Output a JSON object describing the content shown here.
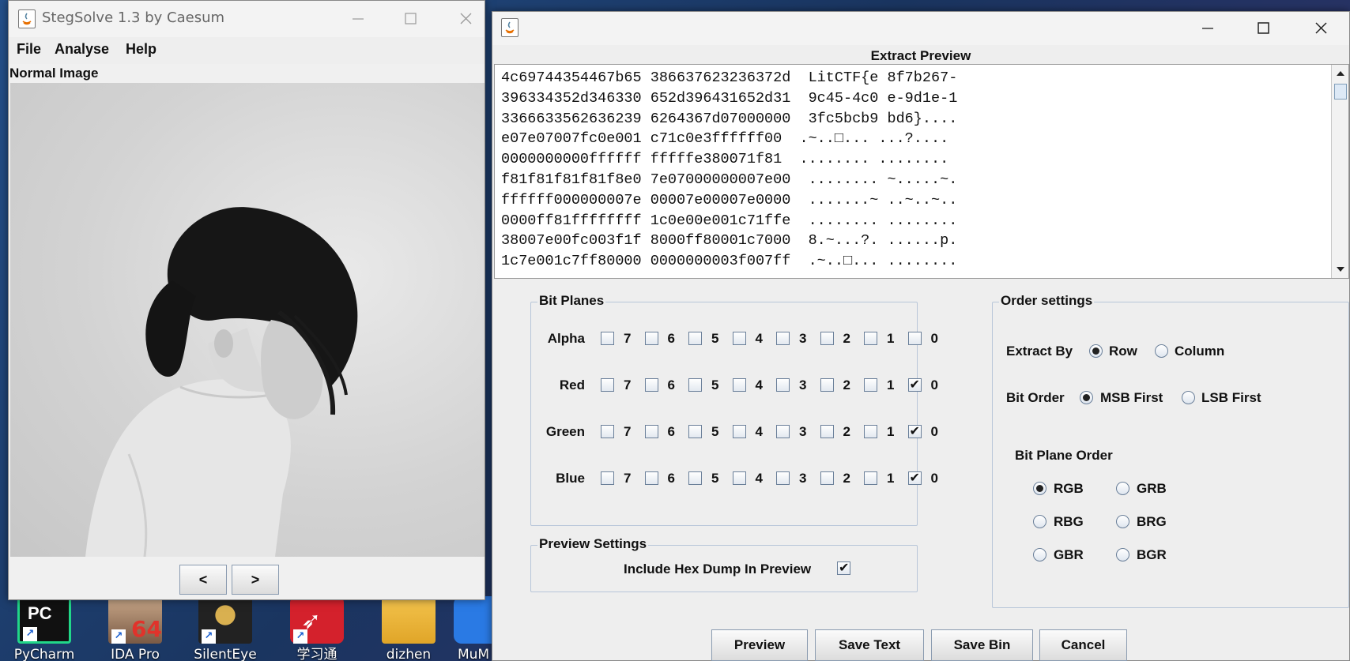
{
  "desktop": {
    "icons": [
      {
        "label": "PyCharm",
        "icon": "pycharm-icon"
      },
      {
        "label": "IDA Pro",
        "icon": "ida-pro-icon",
        "badge": "64"
      },
      {
        "label": "SilentEye",
        "icon": "silenteye-icon"
      },
      {
        "label": "学习通",
        "icon": "xuexitong-icon"
      },
      {
        "label": "dizhen",
        "icon": "folder-icon"
      },
      {
        "label": "MuM",
        "icon": "mumu-icon"
      }
    ]
  },
  "stegsolve": {
    "title": "StegSolve 1.3 by Caesum",
    "menu": [
      "File",
      "Analyse",
      "Help"
    ],
    "image_label": "Normal Image",
    "prev_label": "<",
    "next_label": ">"
  },
  "extract": {
    "title": "Extract Preview",
    "hex_lines": [
      "4c69744354467b65 386637623236372d  LitCTF{e 8f7b267-",
      "396334352d346330 652d396431652d31  9c45-4c0 e-9d1e-1",
      "3366633562636239 6264367d07000000  3fc5bcb9 bd6}....",
      "e07e07007fc0e001 c71c0e3ffffff00  .~..□... ...?....",
      "0000000000ffffff fffffe380071f81  ........ ........",
      "f81f81f81f81f8e0 7e07000000007e00  ........ ~.....~.",
      "ffffff000000007e 00007e00007e0000  .......~ ..~..~..",
      "0000ff81ffffffff 1c0e00e001c71ffe  ........ ........",
      "38007e00fc003f1f 8000ff80001c7000  8.~...?. ......p.",
      "1c7e001c7ff80000 0000000003f007ff  .~..□... ........"
    ],
    "bit_planes": {
      "title": "Bit Planes",
      "bits": [
        "7",
        "6",
        "5",
        "4",
        "3",
        "2",
        "1",
        "0"
      ],
      "rows": [
        {
          "label": "Alpha",
          "checked": []
        },
        {
          "label": "Red",
          "checked": [
            "0"
          ]
        },
        {
          "label": "Green",
          "checked": [
            "0"
          ]
        },
        {
          "label": "Blue",
          "checked": [
            "0"
          ]
        }
      ]
    },
    "preview_settings": {
      "title": "Preview Settings",
      "hex_dump_label": "Include Hex Dump In Preview",
      "hex_dump_checked": true
    },
    "order_settings": {
      "title": "Order settings",
      "extract_by_label": "Extract By",
      "extract_by_options": [
        "Row",
        "Column"
      ],
      "extract_by_selected": "Row",
      "bit_order_label": "Bit Order",
      "bit_order_options": [
        "MSB First",
        "LSB First"
      ],
      "bit_order_selected": "MSB First",
      "plane_order_label": "Bit Plane Order",
      "plane_order_options": [
        "RGB",
        "GRB",
        "RBG",
        "BRG",
        "GBR",
        "BGR"
      ],
      "plane_order_selected": "RGB"
    },
    "buttons": [
      "Preview",
      "Save Text",
      "Save Bin",
      "Cancel"
    ]
  }
}
